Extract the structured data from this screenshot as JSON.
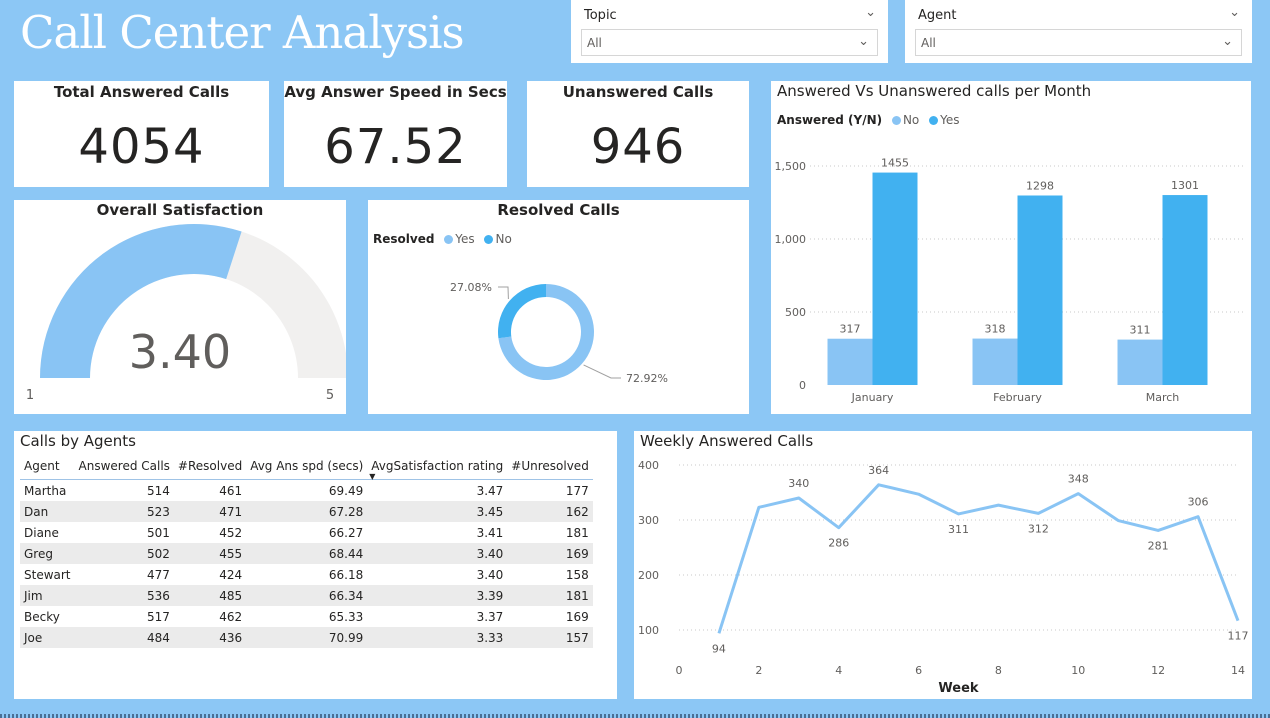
{
  "title": "Call Center Analysis",
  "slicers": [
    {
      "label": "Topic",
      "value": "All"
    },
    {
      "label": "Agent",
      "value": "All"
    }
  ],
  "kpis": {
    "total_answered": {
      "label": "Total Answered Calls",
      "value": "4054"
    },
    "avg_speed": {
      "label": "Avg Answer Speed in Secs",
      "value": "67.52"
    },
    "unanswered": {
      "label": "Unanswered Calls",
      "value": "946"
    }
  },
  "colors": {
    "light": "#89c4f4",
    "dark": "#41b1f0",
    "track": "#f1f0ef",
    "background": "#8cc7f5"
  },
  "chart_data": [
    {
      "type": "gauge",
      "title": "Overall Satisfaction",
      "value": 3.4,
      "value_label": "3.40",
      "min": 1,
      "max": 5,
      "min_label": "1",
      "max_label": "5"
    },
    {
      "type": "pie",
      "title": "Resolved Calls",
      "legend_title": "Resolved",
      "categories": [
        "Yes",
        "No"
      ],
      "values": [
        72.92,
        27.08
      ],
      "labels": [
        "72.92%",
        "27.08%"
      ]
    },
    {
      "type": "bar",
      "title": "Answered Vs Unanswered calls per Month",
      "legend_title": "Answered (Y/N)",
      "categories": [
        "January",
        "February",
        "March"
      ],
      "series": [
        {
          "name": "No",
          "values": [
            317,
            318,
            311
          ]
        },
        {
          "name": "Yes",
          "values": [
            1455,
            1298,
            1301
          ]
        }
      ],
      "ylim": [
        0,
        1500
      ],
      "yticks": [
        "0",
        "500",
        "1,000",
        "1,500"
      ],
      "grid": true,
      "legend_position": "top-left"
    },
    {
      "type": "line",
      "title": "Weekly Answered Calls",
      "xlabel": "Week",
      "x": [
        1,
        2,
        3,
        4,
        5,
        6,
        7,
        8,
        9,
        10,
        11,
        12,
        13,
        14
      ],
      "values": [
        94,
        323,
        340,
        286,
        364,
        347,
        311,
        327,
        312,
        348,
        299,
        281,
        306,
        117
      ],
      "point_labels": {
        "1": "94",
        "3": "340",
        "4": "286",
        "5": "364",
        "7": "311",
        "9": "312",
        "10": "348",
        "12": "281",
        "13": "306",
        "14": "117"
      },
      "xlim": [
        0,
        14
      ],
      "ylim": [
        100,
        400
      ],
      "xticks": [
        "0",
        "2",
        "4",
        "6",
        "8",
        "10",
        "12",
        "14"
      ],
      "yticks": [
        "100",
        "200",
        "300",
        "400"
      ],
      "grid": true
    }
  ],
  "agents_table": {
    "title": "Calls by Agents",
    "columns": [
      "Agent",
      "Answered Calls",
      "#Resolved",
      "Avg Ans spd (secs)",
      "AvgSatisfaction rating",
      "#Unresolved"
    ],
    "sort_indicator": "▼",
    "rows": [
      [
        "Martha",
        "514",
        "461",
        "69.49",
        "3.47",
        "177"
      ],
      [
        "Dan",
        "523",
        "471",
        "67.28",
        "3.45",
        "162"
      ],
      [
        "Diane",
        "501",
        "452",
        "66.27",
        "3.41",
        "181"
      ],
      [
        "Greg",
        "502",
        "455",
        "68.44",
        "3.40",
        "169"
      ],
      [
        "Stewart",
        "477",
        "424",
        "66.18",
        "3.40",
        "158"
      ],
      [
        "Jim",
        "536",
        "485",
        "66.34",
        "3.39",
        "181"
      ],
      [
        "Becky",
        "517",
        "462",
        "65.33",
        "3.37",
        "169"
      ],
      [
        "Joe",
        "484",
        "436",
        "70.99",
        "3.33",
        "157"
      ]
    ]
  }
}
